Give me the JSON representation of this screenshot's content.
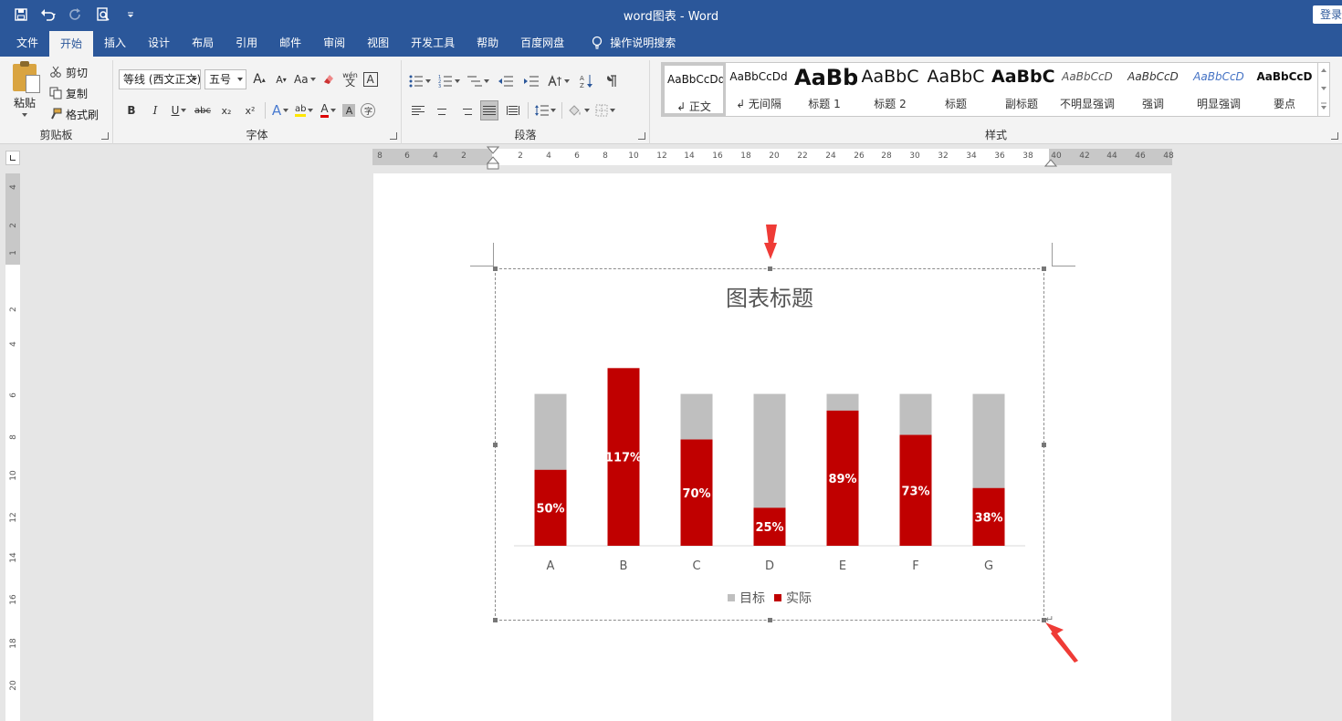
{
  "window": {
    "title": "word图表  -  Word",
    "login": "登录"
  },
  "quick_access": {
    "icons": [
      "save-icon",
      "undo-icon",
      "redo-icon",
      "print-preview-icon",
      "customize-icon"
    ]
  },
  "tabs": [
    "文件",
    "开始",
    "插入",
    "设计",
    "布局",
    "引用",
    "邮件",
    "审阅",
    "视图",
    "开发工具",
    "帮助",
    "百度网盘"
  ],
  "active_tab": "开始",
  "tell_me": "操作说明搜索",
  "clipboard": {
    "paste": "粘贴",
    "cut": "剪切",
    "copy": "复制",
    "format_painter": "格式刷",
    "label": "剪贴板"
  },
  "font": {
    "family": "等线 (西文正文)",
    "size": "五号",
    "label": "字体",
    "grow": "A",
    "shrink": "A",
    "case": "Aa",
    "phonetic": "wén",
    "phonetic_char": "文",
    "border_char": "A",
    "bold": "B",
    "italic": "I",
    "underline": "U",
    "strike": "abc",
    "subscript": "x₂",
    "superscript": "x²",
    "effects": "A",
    "highlight": "ab",
    "color": "A",
    "shading": "A",
    "enclose": "字"
  },
  "paragraph": {
    "label": "段落"
  },
  "styles": {
    "label": "样式",
    "items": [
      {
        "sample": "AaBbCcDd",
        "name": "↲ 正文"
      },
      {
        "sample": "AaBbCcDd",
        "name": "↲ 无间隔"
      },
      {
        "sample": "AaBb",
        "name": "标题 1"
      },
      {
        "sample": "AaBbC",
        "name": "标题 2"
      },
      {
        "sample": "AaBbC",
        "name": "标题"
      },
      {
        "sample": "AaBbC",
        "name": "副标题"
      },
      {
        "sample": "AaBbCcD",
        "name": "不明显强调"
      },
      {
        "sample": "AaBbCcD",
        "name": "强调"
      },
      {
        "sample": "AaBbCcD",
        "name": "明显强调"
      },
      {
        "sample": "AaBbCcD",
        "name": "要点"
      }
    ]
  },
  "ruler": {
    "h_numbers": [
      "8",
      "6",
      "4",
      "2",
      "2",
      "4",
      "6",
      "8",
      "10",
      "12",
      "14",
      "16",
      "18",
      "20",
      "22",
      "24",
      "26",
      "28",
      "30",
      "32",
      "34",
      "36",
      "38",
      "40",
      "42",
      "44",
      "46",
      "48"
    ],
    "v_numbers": [
      "4",
      "2",
      "1",
      "2",
      "4",
      "6",
      "8",
      "10",
      "12",
      "14",
      "16",
      "18",
      "20"
    ]
  },
  "chart_data": {
    "type": "bar",
    "title": "图表标题",
    "categories": [
      "A",
      "B",
      "C",
      "D",
      "E",
      "F",
      "G"
    ],
    "series": [
      {
        "name": "目标",
        "values": [
          100,
          100,
          100,
          100,
          100,
          100,
          100
        ],
        "color": "#bfbfbf"
      },
      {
        "name": "实际",
        "values": [
          50,
          117,
          70,
          25,
          89,
          73,
          38
        ],
        "color": "#c00000"
      }
    ],
    "data_labels": [
      "50%",
      "117%",
      "70%",
      "25%",
      "89%",
      "73%",
      "38%"
    ],
    "overlap": true,
    "ylim": [
      0,
      125
    ],
    "grid": false,
    "legend": "bottom"
  }
}
